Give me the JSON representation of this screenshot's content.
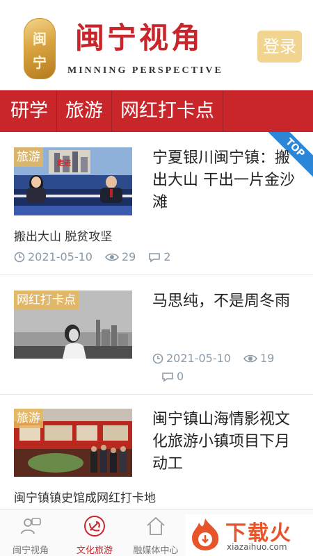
{
  "header": {
    "logo_seal_text": "闽宁",
    "title": "闽宁视角",
    "subtitle": "MINNING PERSPECTIVE",
    "login_label": "登录"
  },
  "nav": {
    "tabs": [
      "研学",
      "旅游",
      "网红打卡点"
    ]
  },
  "articles": [
    {
      "tag": "旅游",
      "title": "宁夏银川闽宁镇：搬出大山 干出一片金沙滩",
      "summary": "搬出大山 脱贫攻坚",
      "date": "2021-05-10",
      "views": "29",
      "comments": "2",
      "badge": "TOP"
    },
    {
      "tag": "网红打卡点",
      "title": "马思纯，不是周冬雨",
      "date": "2021-05-10",
      "views": "19",
      "comments": "0"
    },
    {
      "tag": "旅游",
      "title": "闽宁镇山海情影视文化旅游小镇项目下月动工",
      "summary": "闽宁镇镇史馆成网红打卡地"
    }
  ],
  "tabbar": {
    "items": [
      {
        "label": "闽宁视角",
        "icon": "people-icon"
      },
      {
        "label": "文化旅游",
        "icon": "party-emblem-icon"
      },
      {
        "label": "融媒体中心",
        "icon": "home-icon"
      }
    ]
  },
  "watermark": {
    "text": "下载火",
    "url": "xiazaihuo.com"
  },
  "colors": {
    "brand_red": "#c9262c",
    "login_gold": "#f1d48f",
    "meta_gray": "#8a9aa8",
    "top_badge_blue": "#2b86d8"
  }
}
